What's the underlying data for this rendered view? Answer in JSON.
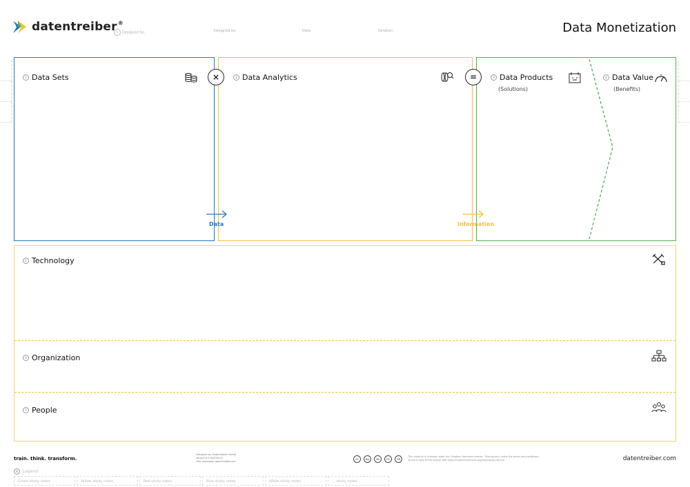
{
  "header": {
    "brand": "datentreiber",
    "registered": "®",
    "title": "Data Monetization",
    "meta": [
      {
        "label": "Designed for:"
      },
      {
        "label": "Designed by:"
      },
      {
        "label": "Date:"
      },
      {
        "label": "Iteration:"
      }
    ]
  },
  "flow": {
    "data_sets": {
      "num": "1",
      "title": "Data Sets"
    },
    "times": "×",
    "data_analytics": {
      "num": "2",
      "title": "Data Analytics"
    },
    "equals": "=",
    "data_products": {
      "num": "3",
      "title": "Data Products",
      "subtitle": "(Solutions)"
    },
    "data_value": {
      "num": "4",
      "title": "Data Value",
      "subtitle": "(Benefits)"
    },
    "arrow_data": "Data",
    "arrow_information": "Information"
  },
  "enablers": {
    "technology": {
      "num": "5",
      "title": "Technology"
    },
    "organization": {
      "num": "6",
      "title": "Organization"
    },
    "people": {
      "num": "7",
      "title": "People"
    }
  },
  "footer": {
    "tagline": "train. think. transform.",
    "credits": [
      "Designed by: Datentreiber GmbH",
      "Version 6.1.0|2018-04",
      "Free download: datentreiber.com"
    ],
    "cc_icons": [
      "cc",
      "by",
      "sa",
      "nc",
      "nd"
    ],
    "license": [
      "This material is licensed under the Creative Commons license: 'Sharing only under the terms and conditions'.",
      "To see a copy of the license visit http://creativecommons.org/licenses/by-sa/4.0/"
    ],
    "url": "datentreiber.com",
    "legend": {
      "num": "8",
      "title": "Legend"
    },
    "legend_cells": [
      "Green sticky notes",
      "Yellow sticky notes",
      "Red sticky notes",
      "Blue sticky notes",
      "White sticky notes",
      "... sticky notes"
    ]
  },
  "colors": {
    "blue": "#1f77c4",
    "yellow": "#f1c232",
    "green": "#4caf50"
  }
}
